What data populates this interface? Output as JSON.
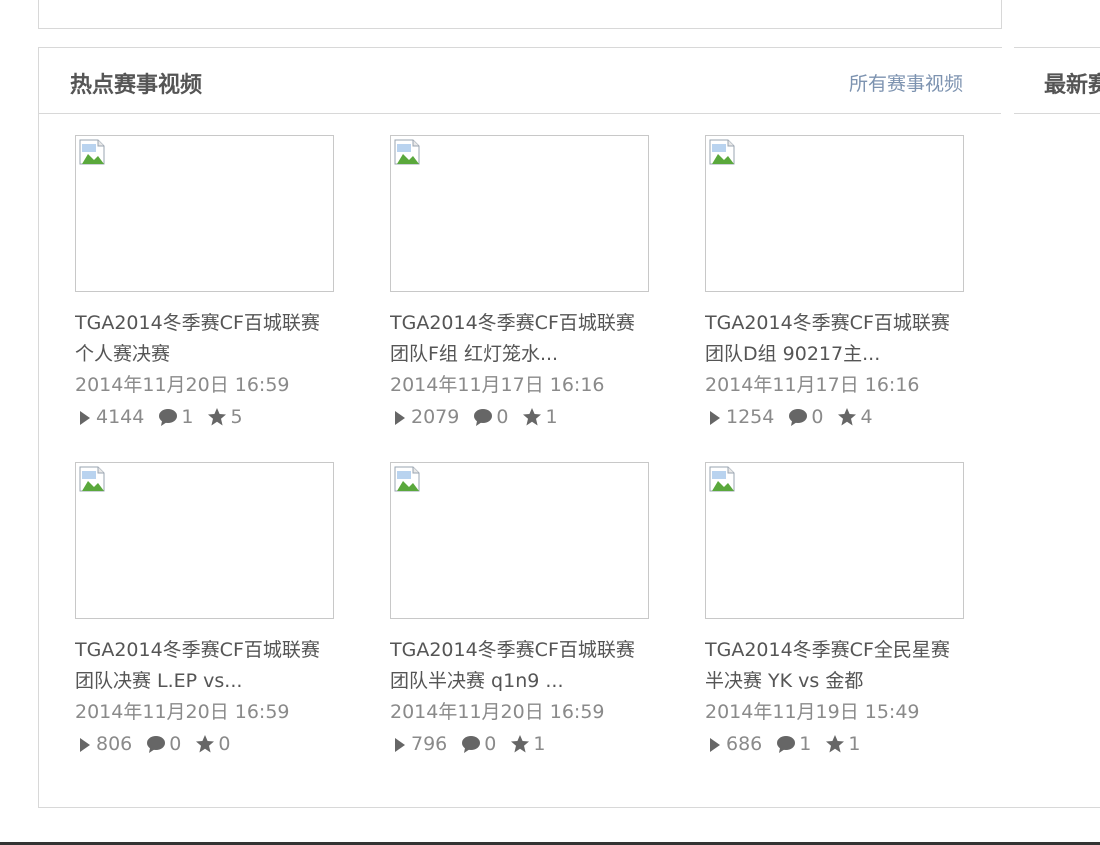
{
  "section": {
    "title": "热点赛事视频",
    "more_link": "所有赛事视频",
    "side_title": "最新赛"
  },
  "videos": [
    {
      "title": "TGA2014冬季赛CF百城联赛\n个人赛决赛",
      "date": "2014年11月20日 16:59",
      "plays": "4144",
      "comments": "1",
      "favorites": "5"
    },
    {
      "title": "TGA2014冬季赛CF百城联赛\n团队F组 红灯笼水...",
      "date": "2014年11月17日 16:16",
      "plays": "2079",
      "comments": "0",
      "favorites": "1"
    },
    {
      "title": "TGA2014冬季赛CF百城联赛\n团队D组 90217主...",
      "date": "2014年11月17日 16:16",
      "plays": "1254",
      "comments": "0",
      "favorites": "4"
    },
    {
      "title": "TGA2014冬季赛CF百城联赛\n团队决赛 L.EP vs...",
      "date": "2014年11月20日 16:59",
      "plays": "806",
      "comments": "0",
      "favorites": "0"
    },
    {
      "title": "TGA2014冬季赛CF百城联赛\n团队半决赛 q1n9 ...",
      "date": "2014年11月20日 16:59",
      "plays": "796",
      "comments": "0",
      "favorites": "1"
    },
    {
      "title": "TGA2014冬季赛CF全民星赛\n半决赛 YK vs 金都",
      "date": "2014年11月19日 15:49",
      "plays": "686",
      "comments": "1",
      "favorites": "1"
    }
  ],
  "icons": {
    "play": "play-icon",
    "comment": "comment-bubble-icon",
    "favorite": "star-icon",
    "thumbnail": "broken-image-icon"
  },
  "colors": {
    "text": "#555555",
    "meta": "#8a8a8a",
    "link": "#7d93b0",
    "border": "#d8d8d8",
    "icon": "#666666"
  }
}
